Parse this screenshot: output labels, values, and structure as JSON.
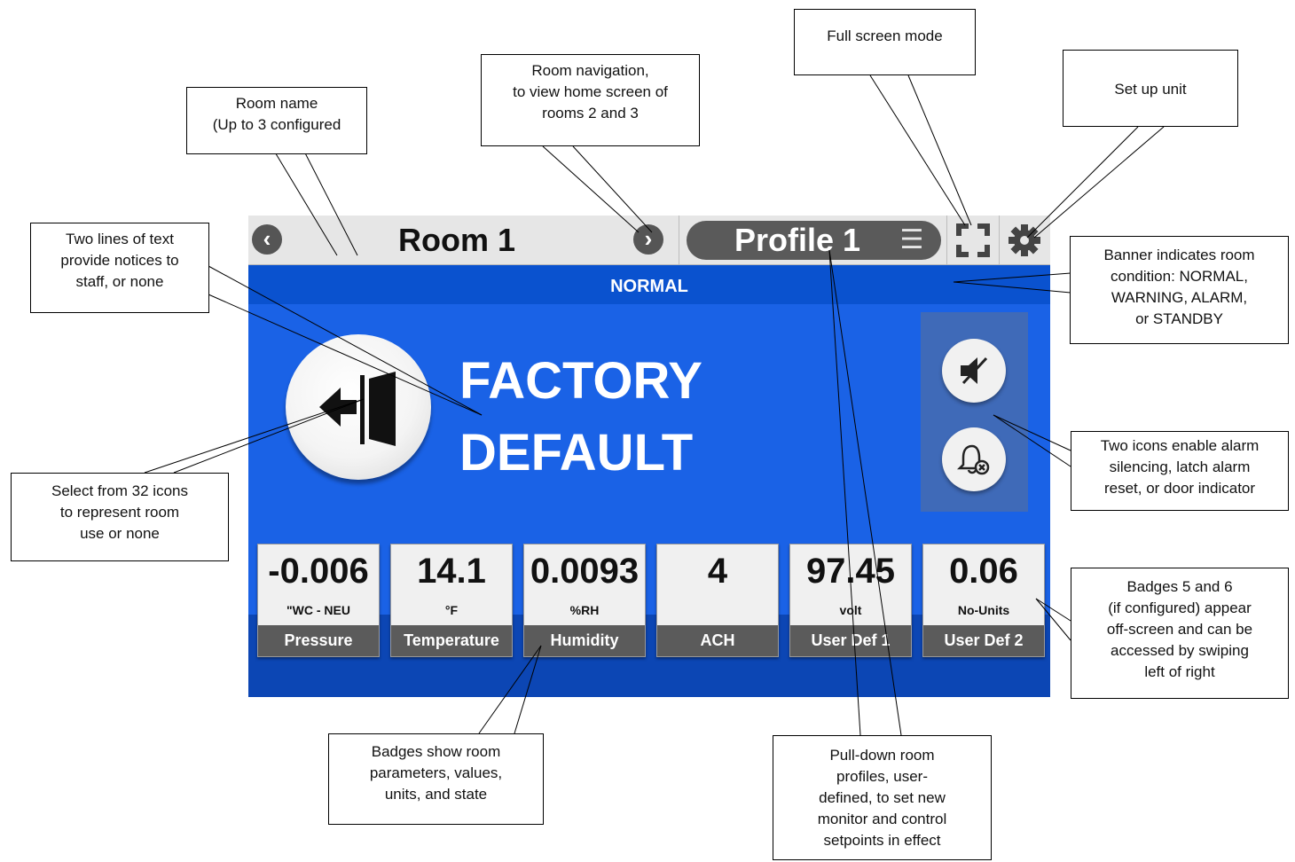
{
  "device": {
    "room_name": "Room 1",
    "profile_name": "Profile 1",
    "banner_status": "NORMAL",
    "notice_line1": "FACTORY",
    "notice_line2": "DEFAULT",
    "nav_prev_icon": "chevron-left-icon",
    "nav_next_icon": "chevron-right-icon",
    "profile_menu_icon": "menu-icon",
    "fullscreen_icon": "fullscreen-icon",
    "settings_icon": "gear-icon",
    "room_icon": "door-exit-icon",
    "alarm_buttons": [
      "speaker-mute-icon",
      "bell-reset-icon"
    ],
    "badges": [
      {
        "value": "-0.006",
        "unit": "\"WC - NEU",
        "label": "Pressure"
      },
      {
        "value": "14.1",
        "unit": "°F",
        "label": "Temperature"
      },
      {
        "value": "0.0093",
        "unit": "%RH",
        "label": "Humidity"
      },
      {
        "value": "4",
        "unit": "",
        "label": "ACH"
      },
      {
        "value": "97.45",
        "unit": "volt",
        "label": "User Def 1"
      },
      {
        "value": "0.06",
        "unit": "No-Units",
        "label": "User Def 2"
      }
    ],
    "colors": {
      "screen_blue": "#1a62e6",
      "banner_blue": "#0a52cf",
      "badge_label_gray": "#5b5b5b"
    }
  },
  "callouts": {
    "room_name": [
      "Room name",
      "(Up to 3 configured"
    ],
    "room_navigation": [
      "Room navigation,",
      "to view home screen of",
      "rooms 2 and 3"
    ],
    "full_screen": [
      "Full screen mode"
    ],
    "set_up": [
      "Set up unit"
    ],
    "notices": [
      "Two lines of text",
      "provide notices to",
      "staff, or none"
    ],
    "banner": [
      "Banner indicates room",
      "condition: NORMAL,",
      "WARNING, ALARM,",
      "or STANDBY"
    ],
    "room_icon": [
      "Select from 32 icons",
      "to represent room",
      "use or none"
    ],
    "alarm_icons": [
      "Two icons enable alarm",
      "silencing, latch alarm",
      "reset, or door indicator"
    ],
    "badges_5_6": [
      "Badges 5 and 6",
      "(if configured) appear",
      "off-screen and can be",
      "accessed by swiping",
      "left of right"
    ],
    "badges": [
      "Badges show room",
      "parameters, values,",
      "units, and state"
    ],
    "profiles": [
      "Pull-down room",
      "profiles, user-",
      "defined, to set new",
      "monitor and control",
      "setpoints in effect"
    ]
  }
}
